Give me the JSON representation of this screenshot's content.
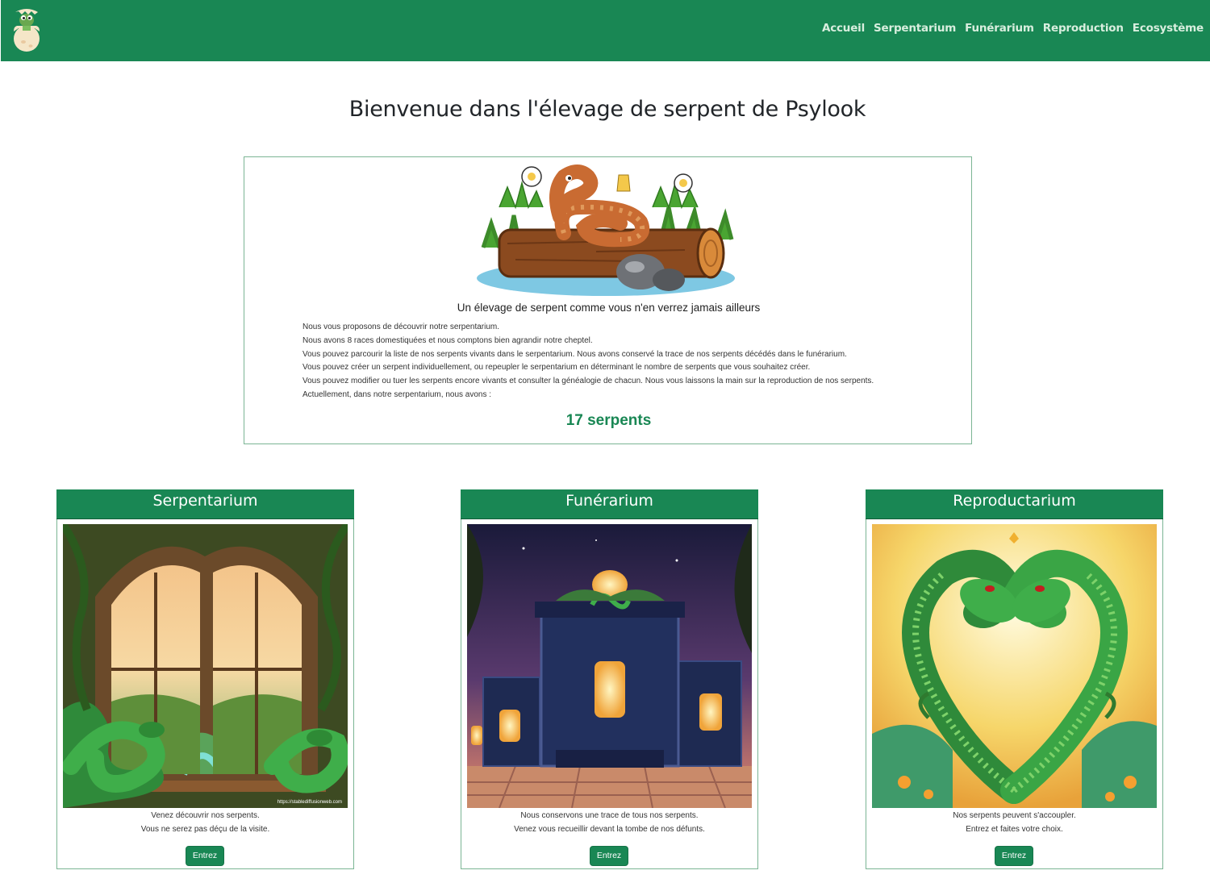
{
  "nav": {
    "links": [
      "Accueil",
      "Serpentarium",
      "Funérarium",
      "Reproduction",
      "Ecosystème"
    ]
  },
  "page_title": "Bienvenue dans l'élevage de serpent de Psylook",
  "intro": {
    "tagline": "Un élevage de serpent comme vous n'en verrez jamais ailleurs",
    "lines": [
      "Nous vous proposons de découvrir notre serpentarium.",
      "Nous avons 8 races domestiquées et nous comptons bien agrandir notre cheptel.",
      "Vous pouvez parcourir la liste de nos serpents vivants dans le serpentarium. Nous avons conservé la trace de nos serpents décédés dans le funérarium.",
      "Vous pouvez créer un serpent individuellement, ou repeupler le serpentarium en déterminant le nombre de serpents que vous souhaitez créer.",
      "Vous pouvez modifier ou tuer les serpents encore vivants et consulter la généalogie de chacun. Nous vous laissons la main sur la reproduction de nos serpents.",
      "Actuellement, dans notre serpentarium, nous avons :"
    ],
    "count": "17 serpents"
  },
  "cards": [
    {
      "title": "Serpentarium",
      "line1": "Venez découvrir nos serpents.",
      "line2": "Vous ne serez pas déçu de la visite.",
      "button": "Entrez",
      "watermark": "https://stablediffusionweb.com"
    },
    {
      "title": "Funérarium",
      "line1": "Nous conservons une trace de tous nos serpents.",
      "line2": "Venez vous recueillir devant la tombe de nos défunts.",
      "button": "Entrez"
    },
    {
      "title": "Reproductarium",
      "line1": "Nos serpents peuvent s'accoupler.",
      "line2": "Entrez et faites votre choix.",
      "button": "Entrez"
    }
  ],
  "colors": {
    "primary": "#198754",
    "border": "#7bb594"
  },
  "icons": [
    "snake-egg-logo-icon"
  ]
}
